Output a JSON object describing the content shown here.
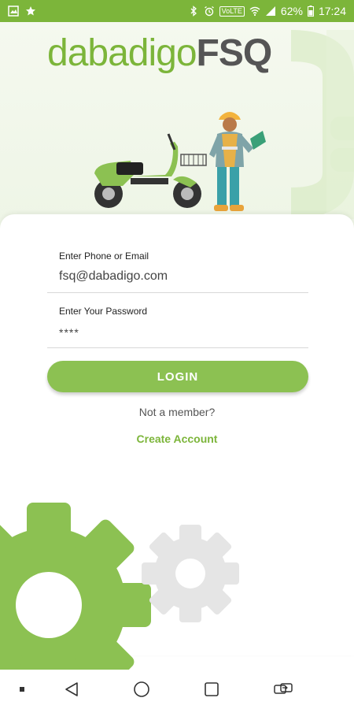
{
  "status_bar": {
    "left_icons": [
      "gallery-icon",
      "star-icon"
    ],
    "right_icons": [
      "bluetooth-icon",
      "alarm-icon",
      "wifi-icon",
      "signal-icon",
      "battery-icon"
    ],
    "volte": "VoLTE",
    "battery": "62%",
    "time": "17:24"
  },
  "hero": {
    "logo_part1": "dabadigo",
    "logo_part2": "FSQ",
    "illustration": [
      "scooter-illustration",
      "worker-illustration",
      "plug-icon"
    ]
  },
  "form": {
    "email_label": "Enter Phone or Email",
    "email_value": "fsq@dabadigo.com",
    "password_label": "Enter Your Password",
    "password_value": "****",
    "login_label": "LOGIN",
    "not_member_text": "Not a member?",
    "create_account_label": "Create Account"
  },
  "colors": {
    "accent": "#8cc152",
    "status_bar": "#7cb53a",
    "gear_light": "#e5e5e5"
  },
  "nav_bar": {
    "buttons": [
      "dot-icon",
      "back-icon",
      "home-icon",
      "recents-icon",
      "switch-apps-icon"
    ]
  }
}
